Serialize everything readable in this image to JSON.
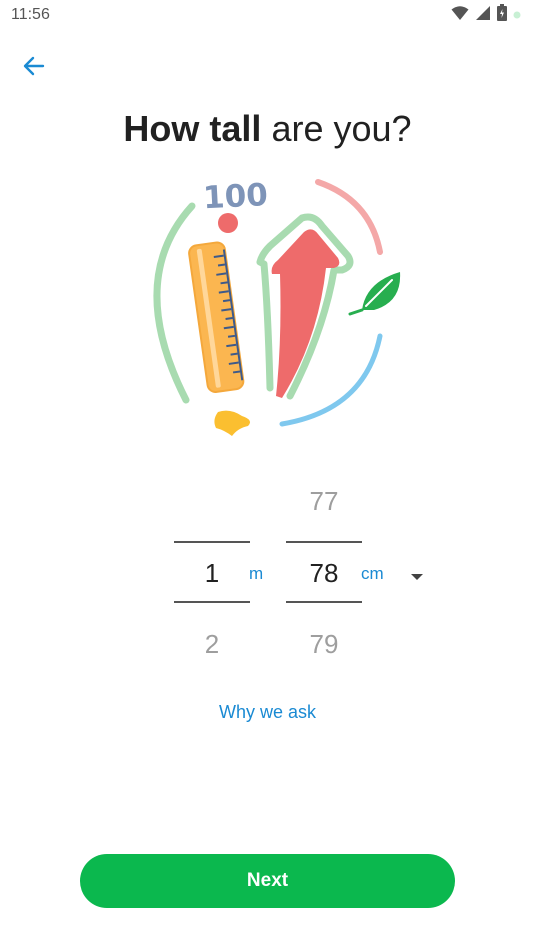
{
  "status_bar": {
    "time": "11:56",
    "icons": [
      "wifi-icon",
      "signal-icon",
      "battery-icon",
      "notification-dot-icon"
    ]
  },
  "header": {
    "back_icon": "arrow-left-icon"
  },
  "title": {
    "bold_part": "How tall",
    "rest": "are you?"
  },
  "illustration": {
    "badge_text": "100"
  },
  "picker": {
    "meters": {
      "above": "",
      "selected": "1",
      "below": "2",
      "unit": "m"
    },
    "centimeters": {
      "above": "77",
      "selected": "78",
      "below": "79",
      "unit": "cm"
    },
    "unit_dropdown_icon": "caret-down-icon"
  },
  "why_link": "Why we ask",
  "next_button": "Next",
  "colors": {
    "accent_blue": "#1a8ad3",
    "button_green": "#0bb84e"
  }
}
